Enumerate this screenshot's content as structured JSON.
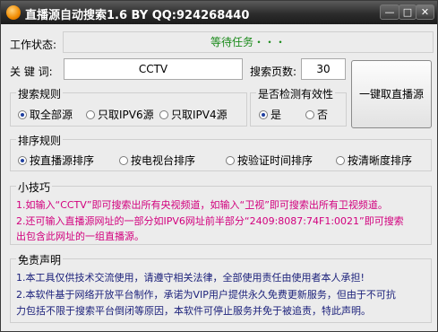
{
  "window": {
    "title": "直播源自动搜索1.6 BY QQ:924268440",
    "controls": {
      "minimize": "—",
      "maximize": "□",
      "close": "✕"
    }
  },
  "status": {
    "label": "工作状态:",
    "value": "等待任务・・・"
  },
  "keyword": {
    "label": "关 键 词:",
    "value": "CCTV"
  },
  "pages": {
    "label": "搜索页数:",
    "value": "30"
  },
  "action_button": "一键取直播源",
  "search_rule": {
    "title": "搜索规则",
    "options": [
      {
        "label": "取全部源",
        "selected": true
      },
      {
        "label": "只取IPV6源",
        "selected": false
      },
      {
        "label": "只取IPV4源",
        "selected": false
      }
    ]
  },
  "check_valid": {
    "title": "是否检测有效性",
    "options": [
      {
        "label": "是",
        "selected": true
      },
      {
        "label": "否",
        "selected": false
      }
    ]
  },
  "sort_rule": {
    "title": "排序规则",
    "options": [
      {
        "label": "按直播源排序",
        "selected": true
      },
      {
        "label": "按电视台排序",
        "selected": false
      },
      {
        "label": "按验证时间排序",
        "selected": false
      },
      {
        "label": "按清晰度排序",
        "selected": false
      }
    ]
  },
  "tips": {
    "title": "小技巧",
    "lines": [
      "1.如输入“CCTV”即可搜索出所有央视频道，如输入“卫视”即可搜索出所有卫视频道。",
      "2.还可输入直播源网址的一部分如IPV6网址前半部分“2409:8087:74F1:0021”即可搜索",
      "  出包含此网址的一组直播源。"
    ]
  },
  "disclaimer": {
    "title": "免责声明",
    "lines": [
      "1.本工具仅供技术交流使用，请遵守相关法律，全部使用责任由使用者本人承担!",
      "2.本软件基于网络开放平台制作，承诺为VIP用户提供永久免费更新服务，但由于不可抗",
      "  力包括不限于搜索平台倒闭等原因，本软件可停止服务并免于被追责，特此声明。"
    ]
  },
  "colors": {
    "status": "#1a8a1a",
    "tips": "#d2007e",
    "disclaimer": "#1a1f7a",
    "radio_dot": "#1f3f9f"
  }
}
